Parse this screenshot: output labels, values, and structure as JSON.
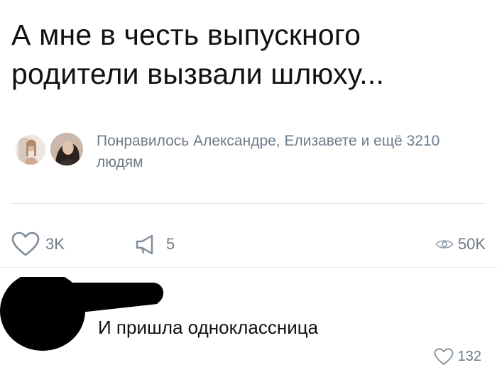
{
  "post": {
    "text": "А мне в честь выпускного родители вызвали шлюху..."
  },
  "likes_summary": {
    "text": "Понравилось Александре, Елизавете и ещё 3210 людям"
  },
  "actions": {
    "likes": "3K",
    "shares": "5",
    "views": "50K"
  },
  "comment": {
    "text": "И пришла одноклассница",
    "likes": "132"
  },
  "icons": {
    "like": "heart-outline-icon",
    "share": "megaphone-outline-icon",
    "views": "eye-icon"
  },
  "colors": {
    "meta_text": "#6e7b88",
    "redaction": "#000000"
  }
}
